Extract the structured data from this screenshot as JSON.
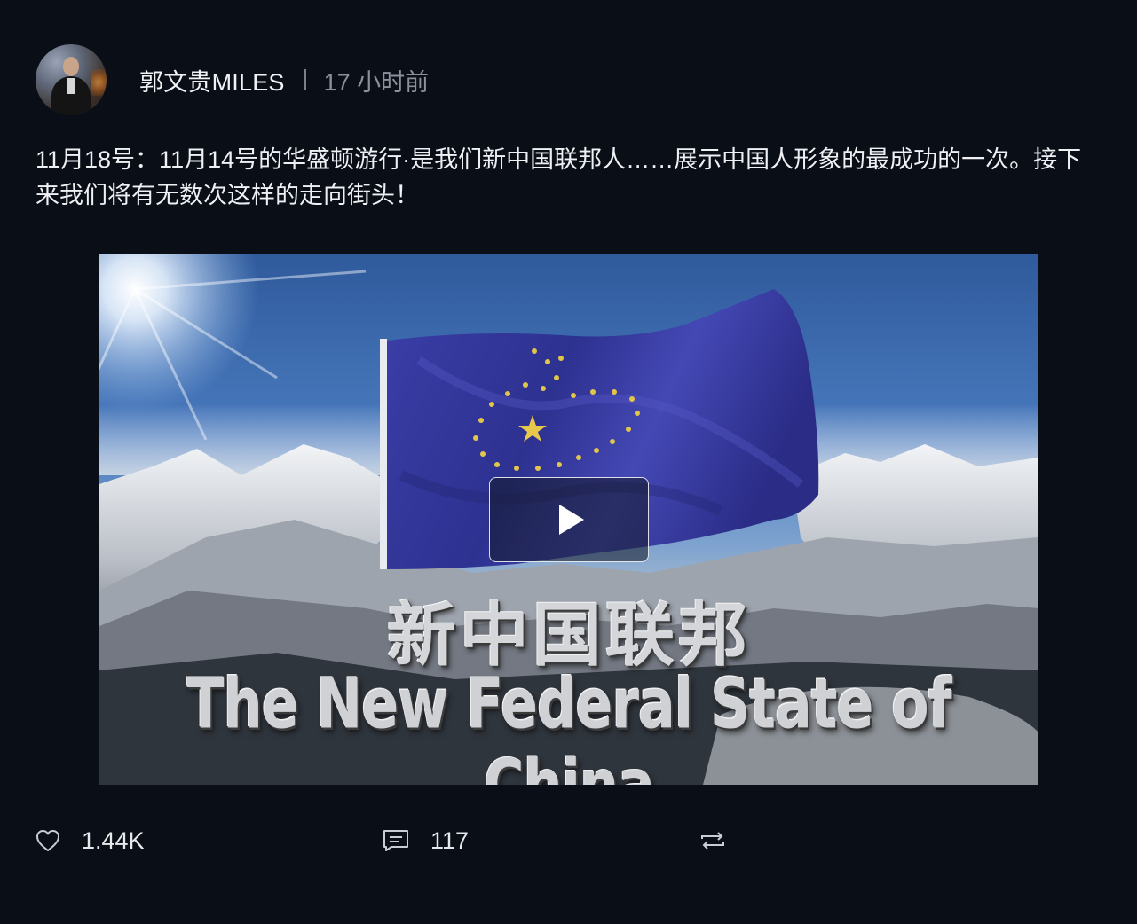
{
  "post": {
    "author": "郭文贵MILES",
    "time": "17 小时前",
    "text": "11月18号：11月14号的华盛顿游行·是我们新中国联邦人……展示中国人形象的最成功的一次。接下来我们将有无数次这样的走向街头！",
    "video": {
      "title_cn": "新中国联邦",
      "title_en": "The New Federal State of China",
      "flag_color": "#3a3e9e"
    }
  },
  "actions": {
    "likes": "1.44K",
    "comments": "117"
  },
  "icons": {
    "like": "heart-icon",
    "comment": "comment-icon",
    "repost": "repost-icon",
    "play": "play-icon"
  }
}
